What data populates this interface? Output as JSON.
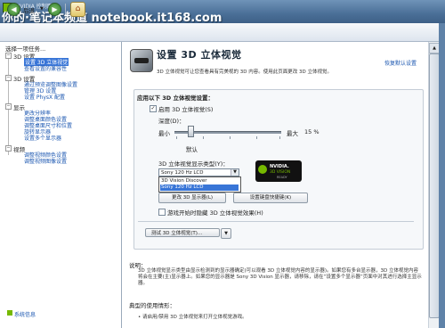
{
  "window": {
    "title": "NVIDIA 控制面板",
    "watermark": "你的·笔记本频道 notebook.it168.com"
  },
  "toolbar": {
    "back_label": "后退",
    "back_icon": "back-arrow-icon",
    "forward_icon": "forward-arrow-icon",
    "home_icon": "home-icon"
  },
  "sidebar": {
    "header": "选择一项任务...",
    "categories": [
      {
        "label": "3D 设置",
        "items": [
          {
            "label": "设置 3D 立体视觉",
            "selected": true
          },
          {
            "label": "查看设置的兼容性"
          }
        ]
      },
      {
        "label": "3D 设置",
        "items": [
          {
            "label": "通过预览调整图像设置"
          },
          {
            "label": "管理 3D 设置"
          },
          {
            "label": "设置 PhysX 配置"
          }
        ]
      },
      {
        "label": "显示",
        "items": [
          {
            "label": "更改分辨率"
          },
          {
            "label": "调整桌面颜色设置"
          },
          {
            "label": "调整桌面尺寸和位置"
          },
          {
            "label": "旋转显示器"
          },
          {
            "label": "设置多个显示器"
          }
        ]
      },
      {
        "label": "视频",
        "items": [
          {
            "label": "调整视频颜色设置"
          },
          {
            "label": "调整视频图像设置"
          }
        ]
      }
    ],
    "system_info": "系统信息"
  },
  "main": {
    "title": "设置 3D 立体视觉",
    "restore_defaults": "恢复默认设置",
    "description": "3D 立体视觉可让您查看具有完美视的 3D 内容。使用此页面更改 3D 立体视觉。",
    "section_title": "应用以下 3D 立体视觉设置：",
    "enable_checkbox": {
      "label": "启用 3D 立体视觉(S)",
      "checked": true
    },
    "depth": {
      "label": "深度(D)：",
      "min_label": "最小",
      "max_label": "最大",
      "value_text": "15 %",
      "value": 15,
      "sublabel": "默认"
    },
    "display_type": {
      "label": "3D 立体视觉显示类型(Y)：",
      "selected": "Sony 120 Hz LCD",
      "options": [
        "3D Vision Discover",
        "Sony 120 Hz LCD"
      ],
      "highlighted": "Sony 120 Hz LCD"
    },
    "logo": {
      "line1": "NVIDIA.",
      "line2": "3D VISION",
      "line3": "READY"
    },
    "buttons": {
      "change_display": "更改 3D 显示器(L)",
      "set_shortcuts": "设置键盘快捷键(K)",
      "test": "测试 3D 立体视觉(T)..."
    },
    "in_game_checkbox": {
      "label": "游戏开始时隐藏 3D 立体视觉效果(H)",
      "checked": false
    },
    "notes_title": "说明：",
    "notes_body": "3D 立体视觉显示类型由显示检测到的显示器确定(可以观看 3D 立体视觉内容的显示器)。如果您有多台显示器，3D 立体视觉内容将会在主要(主)显示器上。如果您的显示器是 Sony 3D Vision 显示器，请移除，请在“设置多个显示器”页面中对其进行选择主显示器。",
    "typical_title": "典型的使用情形：",
    "typical_item": "• 请启用/禁用 3D 立体视觉来打开立体视觉游戏。"
  }
}
